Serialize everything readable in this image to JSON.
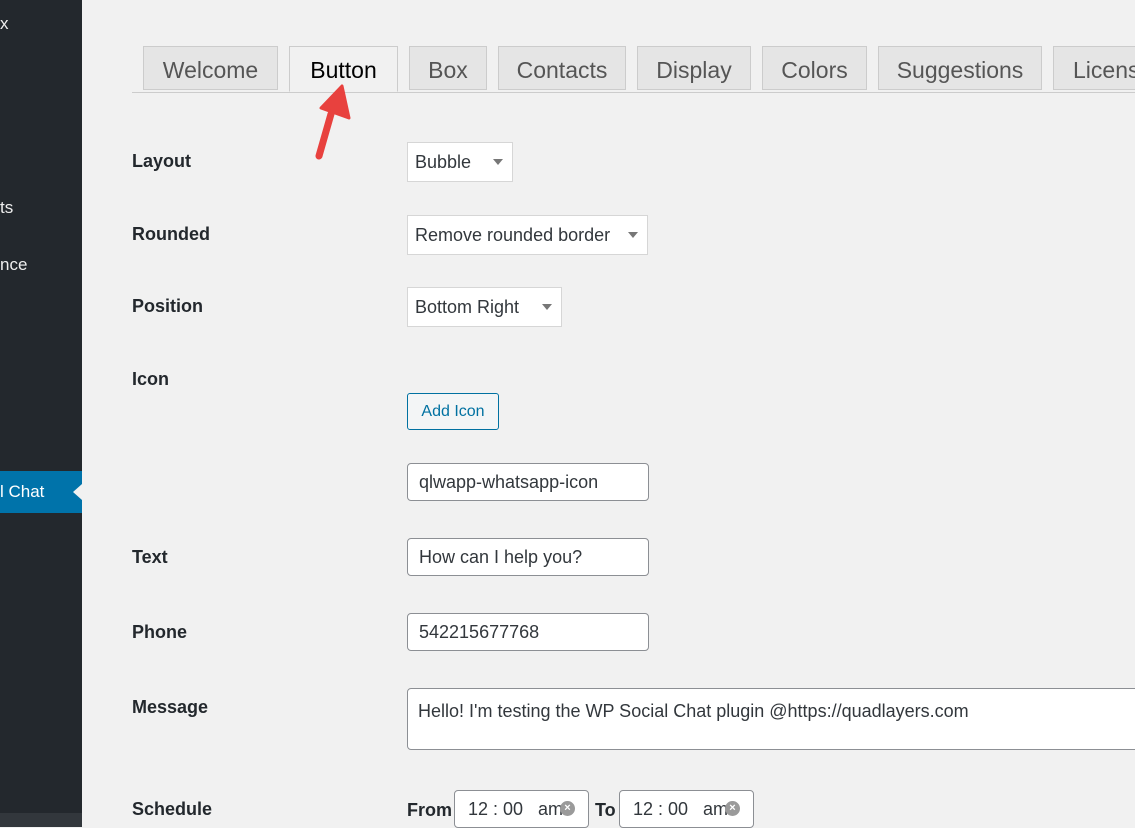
{
  "sidebar": {
    "items": [
      {
        "label": "x"
      },
      {
        "label": "ts"
      },
      {
        "label": "nce"
      }
    ],
    "active_label": "l Chat"
  },
  "header": {
    "partial_text": ""
  },
  "tabs": [
    {
      "label": "Welcome"
    },
    {
      "label": "Button"
    },
    {
      "label": "Box"
    },
    {
      "label": "Contacts"
    },
    {
      "label": "Display"
    },
    {
      "label": "Colors"
    },
    {
      "label": "Suggestions"
    },
    {
      "label": "Licens"
    }
  ],
  "form": {
    "layout": {
      "label": "Layout",
      "value": "Bubble"
    },
    "rounded": {
      "label": "Rounded",
      "value": "Remove rounded border"
    },
    "position": {
      "label": "Position",
      "value": "Bottom Right"
    },
    "icon": {
      "label": "Icon",
      "button_label": "Add Icon",
      "value": "qlwapp-whatsapp-icon"
    },
    "text": {
      "label": "Text",
      "value": "How can I help you?"
    },
    "phone": {
      "label": "Phone",
      "value": "542215677768"
    },
    "message": {
      "label": "Message",
      "value": "Hello! I'm testing the WP Social Chat plugin @https://quadlayers.com"
    },
    "schedule": {
      "label": "Schedule",
      "from_label": "From",
      "to_label": "To",
      "from_value": "12 : 00   am",
      "to_value": "12 : 00   am"
    }
  },
  "colors": {
    "sidebar_bg": "#23282d",
    "active_menu": "#0073aa",
    "page_bg": "#f1f1f1",
    "arrow": "#e8413e",
    "link": "#0071a1"
  }
}
